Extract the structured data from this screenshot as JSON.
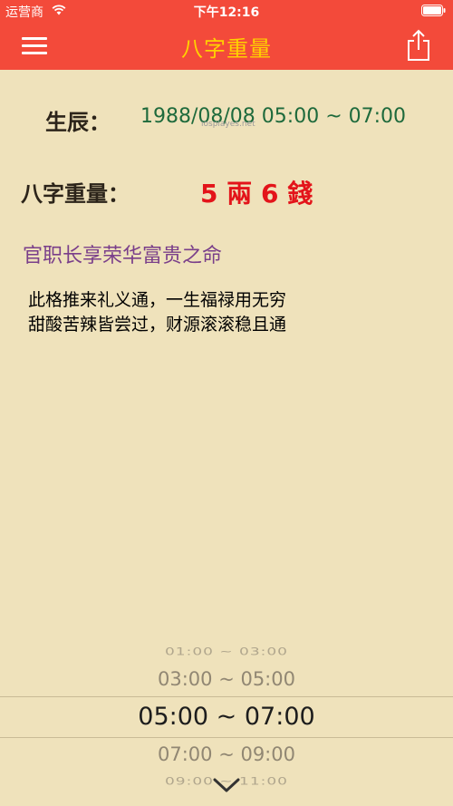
{
  "status_bar": {
    "carrier": "运营商",
    "time": "下午12:16",
    "wifi_icon": "wifi-icon",
    "battery_icon": "battery-icon"
  },
  "nav": {
    "title": "八字重量",
    "menu_icon": "hamburger-menu-icon",
    "share_icon": "share-icon"
  },
  "birth": {
    "label": "生辰：",
    "value": "1988/08/08   05:00 ~ 07:00"
  },
  "watermark": "iosplayes.net",
  "weight": {
    "label": "八字重量：",
    "value": "5 兩 6 錢"
  },
  "fate": {
    "title": "官职长享荣华富贵之命",
    "poem_line1": "此格推来礼义通，一生福禄用无穷",
    "poem_line2": "甜酸苦辣皆尝过，财源滚滚稳且通"
  },
  "picker": {
    "options": [
      "01:00 ~ 03:00",
      "03:00 ~ 05:00",
      "05:00 ~ 07:00",
      "07:00 ~ 09:00",
      "09:00 ~ 11:00"
    ],
    "selected_index": 2,
    "collapse_icon": "chevron-down-icon"
  },
  "colors": {
    "header": "#f34a3a",
    "nav_title": "#ffd100",
    "background": "#efe2bb",
    "birth_value": "#1e6a3c",
    "weight_value": "#e3141a",
    "fate_title": "#7a3f8a"
  }
}
